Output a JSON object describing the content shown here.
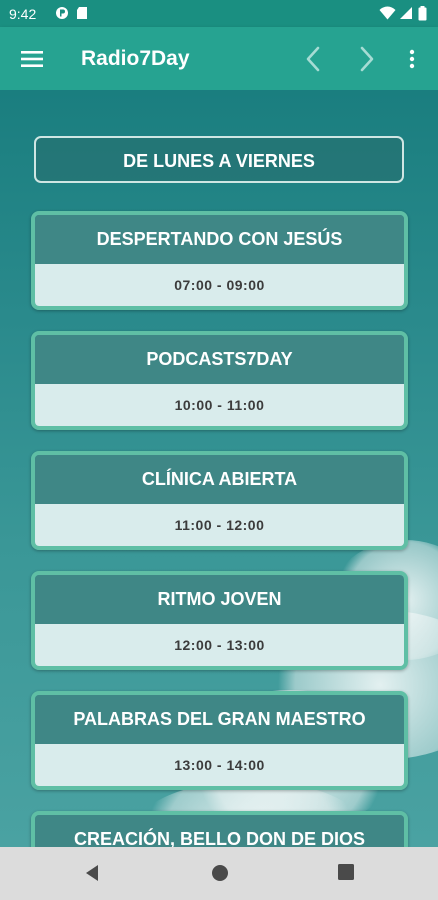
{
  "status_bar": {
    "time": "9:42",
    "icons": [
      "data-saver-icon",
      "sd-card-icon",
      "wifi-icon",
      "signal-icon",
      "battery-icon"
    ]
  },
  "app_bar": {
    "title": "Radio7Day",
    "icons": [
      "menu-icon",
      "chevron-left-icon",
      "chevron-right-icon",
      "more-vert-icon"
    ]
  },
  "schedule": {
    "heading": "DE LUNES A VIERNES",
    "programs": [
      {
        "name": "DESPERTANDO CON JESÚS",
        "hours": "07:00 - 09:00"
      },
      {
        "name": "PODCASTS7DAY",
        "hours": "10:00 - 11:00"
      },
      {
        "name": "CLÍNICA ABIERTA",
        "hours": "11:00 - 12:00"
      },
      {
        "name": "RITMO JOVEN",
        "hours": "12:00 - 13:00"
      },
      {
        "name": "PALABRAS DEL GRAN MAESTRO",
        "hours": "13:00 - 14:00"
      },
      {
        "name": "CREACIÓN, BELLO DON DE DIOS",
        "hours": ""
      }
    ]
  },
  "nav_bar": {
    "icons": [
      "back-icon",
      "home-icon",
      "recents-icon"
    ]
  },
  "colors": {
    "status_bar": "#1a8f81",
    "app_bar": "#26a391",
    "card_border": "#5fbfa5",
    "card_title_bg": "#3f8786",
    "card_hours_bg": "#d9ecec"
  }
}
